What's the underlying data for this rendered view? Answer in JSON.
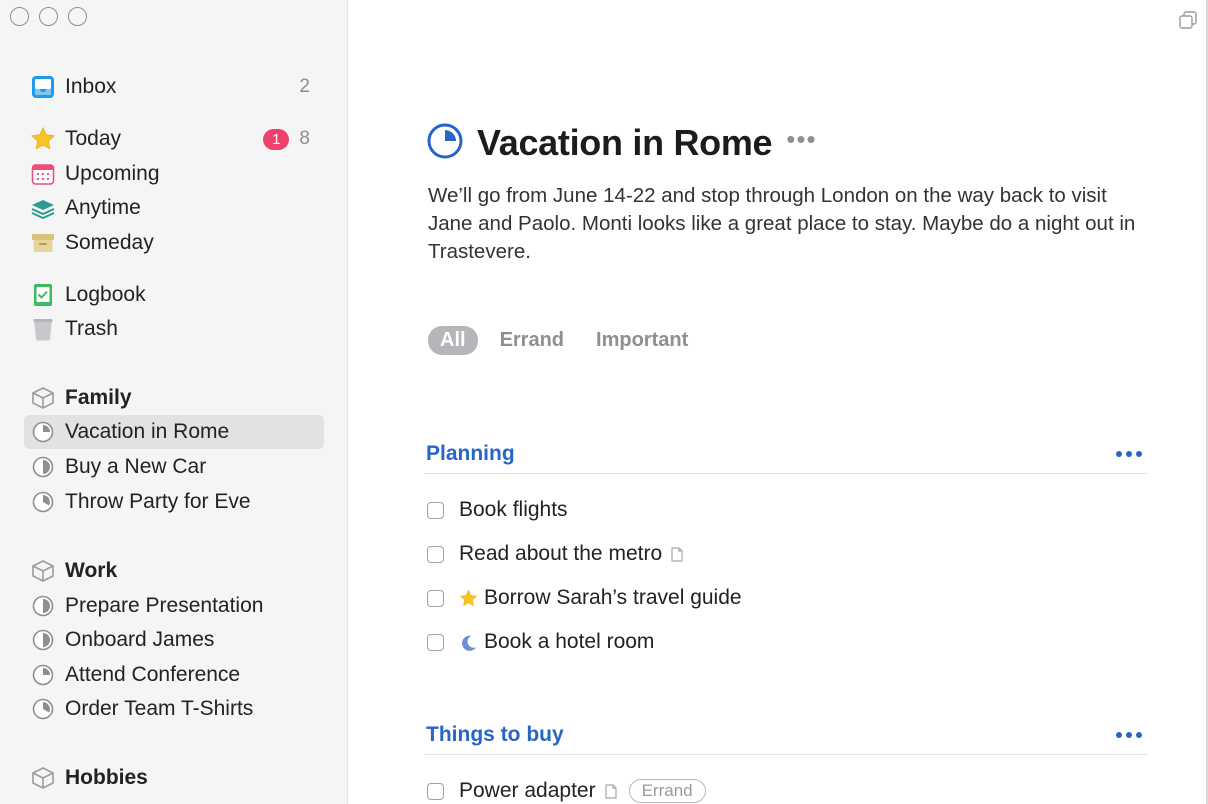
{
  "window": {
    "controls": [
      "close",
      "minimize",
      "zoom"
    ]
  },
  "sidebar": {
    "inbox": {
      "label": "Inbox",
      "count": "2",
      "icon": "inbox-icon"
    },
    "today": {
      "label": "Today",
      "badge": "1",
      "count": "8",
      "icon": "star-icon"
    },
    "upcoming": {
      "label": "Upcoming",
      "icon": "calendar-icon"
    },
    "anytime": {
      "label": "Anytime",
      "icon": "layers-icon"
    },
    "someday": {
      "label": "Someday",
      "icon": "archive-box-icon"
    },
    "logbook": {
      "label": "Logbook",
      "icon": "logbook-icon"
    },
    "trash": {
      "label": "Trash",
      "icon": "trash-icon"
    },
    "areas": [
      {
        "name": "Family",
        "projects": [
          "Vacation in Rome",
          "Buy a New Car",
          "Throw Party for Eve"
        ]
      },
      {
        "name": "Work",
        "projects": [
          "Prepare Presentation",
          "Onboard James",
          "Attend Conference",
          "Order Team T-Shirts"
        ]
      },
      {
        "name": "Hobbies",
        "projects": []
      }
    ]
  },
  "project": {
    "title": "Vacation in Rome",
    "more": "•••",
    "notes": "We’ll go from June 14-22 and stop through London on the way back to visit Jane and Paolo. Monti looks like a great place to stay. Maybe do a night out in Trastevere.",
    "filters": [
      "All",
      "Errand",
      "Important"
    ],
    "active_filter": "All",
    "headings": [
      {
        "label": "Planning",
        "todos": [
          {
            "text": "Book flights"
          },
          {
            "text": "Read about the metro",
            "has_note": true
          },
          {
            "text": "Borrow Sarah’s travel guide",
            "icon": "star-icon"
          },
          {
            "text": "Book a hotel room",
            "icon": "moon-icon"
          }
        ]
      },
      {
        "label": "Things to buy",
        "todos": [
          {
            "text": "Power adapter",
            "has_note": true,
            "tag": "Errand"
          }
        ]
      }
    ]
  },
  "colors": {
    "accent_blue": "#2765c6",
    "badge_pink": "#f0416c",
    "sidebar_bg": "#f5f5f6",
    "selected_bg": "#e2e2e5"
  }
}
